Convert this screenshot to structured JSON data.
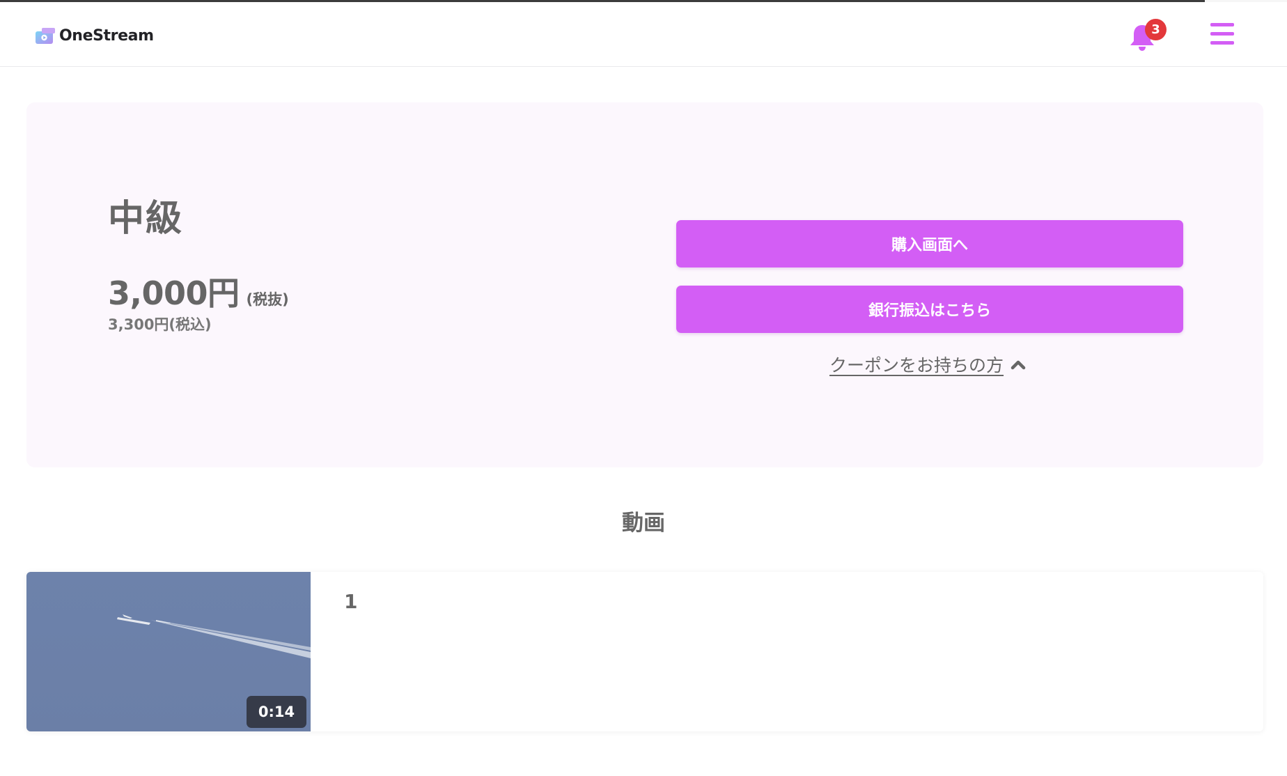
{
  "colors": {
    "accent": "#d35ef5",
    "badge": "#e3383b",
    "hero_background": "#fcf7fd",
    "text": "#666666"
  },
  "header": {
    "brand": "OneStream",
    "logo_icon": "camera-logo-icon",
    "notification_icon": "bell-icon",
    "notification_count": "3",
    "menu_icon": "hamburger-menu-icon"
  },
  "plan": {
    "title": "中級",
    "price": "3,000円",
    "price_note": "(税抜)",
    "price_tax_included": "3,300円(税込)"
  },
  "actions": {
    "purchase_label": "購入画面へ",
    "bank_transfer_label": "銀行振込はこちら",
    "coupon_label": "クーポンをお持ちの方",
    "coupon_icon": "chevron-up-icon"
  },
  "videos_section": {
    "title": "動画",
    "items": [
      {
        "title": "1",
        "duration": "0:14",
        "thumbnail": "airplane-contrail-thumbnail"
      }
    ]
  }
}
